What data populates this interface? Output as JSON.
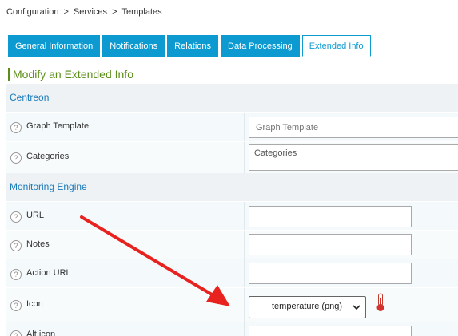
{
  "breadcrumb": {
    "items": [
      "Configuration",
      "Services",
      "Templates"
    ],
    "separator": ">"
  },
  "tabs": [
    {
      "label": "General Information"
    },
    {
      "label": "Notifications"
    },
    {
      "label": "Relations"
    },
    {
      "label": "Data Processing"
    },
    {
      "label": "Extended Info"
    }
  ],
  "form": {
    "title": "Modify an Extended Info",
    "sections": {
      "centreon": "Centreon",
      "monitoring": "Monitoring Engine"
    },
    "fields": {
      "graph_template": {
        "label": "Graph Template",
        "placeholder": "Graph Template"
      },
      "categories": {
        "label": "Categories",
        "placeholder": "Categories"
      },
      "url": {
        "label": "URL",
        "value": ""
      },
      "notes": {
        "label": "Notes",
        "value": ""
      },
      "action_url": {
        "label": "Action URL",
        "value": ""
      },
      "icon": {
        "label": "Icon",
        "selected": "temperature (png)",
        "preview_icon": "thermometer-icon"
      },
      "alt_icon": {
        "label": "Alt icon",
        "value": ""
      }
    },
    "help_glyph": "?"
  },
  "colors": {
    "accent": "#0d9ad1",
    "title_green": "#5b8d18",
    "section_blue": "#1a7ab8",
    "annotation_arrow": "#e8231f"
  }
}
